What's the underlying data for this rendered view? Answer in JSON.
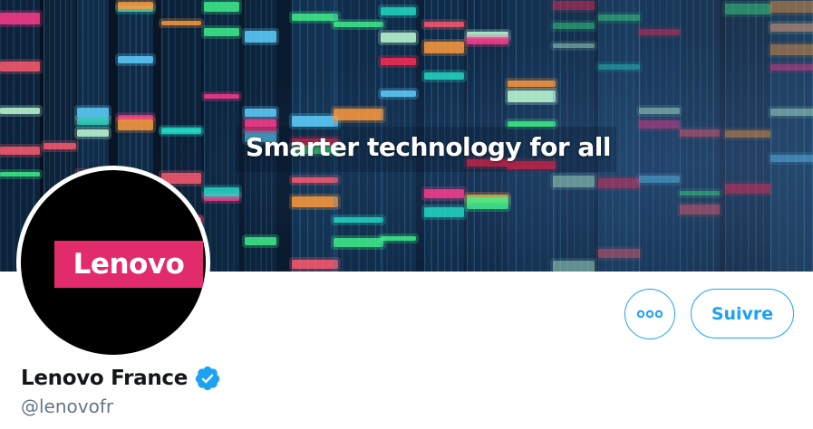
{
  "banner": {
    "tagline": "Smarter technology for all"
  },
  "avatar": {
    "logo_text": "Lenovo",
    "logo_color": "#e12b6b"
  },
  "actions": {
    "more_icon": "more-horizontal-icon",
    "follow_label": "Suivre",
    "accent_color": "#1da1f2"
  },
  "profile": {
    "name": "Lenovo France",
    "verified_icon": "verified-badge-icon",
    "handle": "@lenovofr"
  }
}
